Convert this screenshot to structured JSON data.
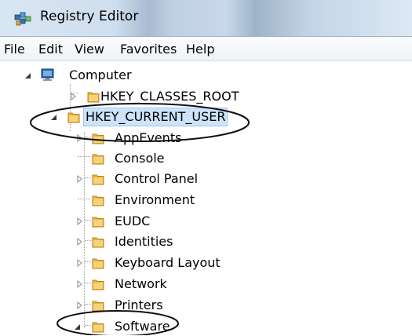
{
  "window": {
    "title": "Registry Editor"
  },
  "menu": [
    "File",
    "Edit",
    "View",
    "Favorites",
    "Help"
  ],
  "tree": {
    "root": "Computer",
    "hives": [
      "HKEY_CLASSES_ROOT",
      "HKEY_CURRENT_USER"
    ],
    "current_user_children": [
      "AppEvents",
      "Console",
      "Control Panel",
      "Environment",
      "EUDC",
      "Identities",
      "Keyboard Layout",
      "Network",
      "Printers",
      "Software"
    ]
  },
  "colors": {
    "selection": "#cce3f8",
    "folder": "#e9b33a",
    "annotation": "#111111"
  },
  "icons": {
    "app": "registry-editor-icon",
    "computer": "computer-icon",
    "folder": "folder-icon",
    "expanded": "expanded-triangle-icon",
    "collapsed": "collapsed-triangle-icon"
  }
}
